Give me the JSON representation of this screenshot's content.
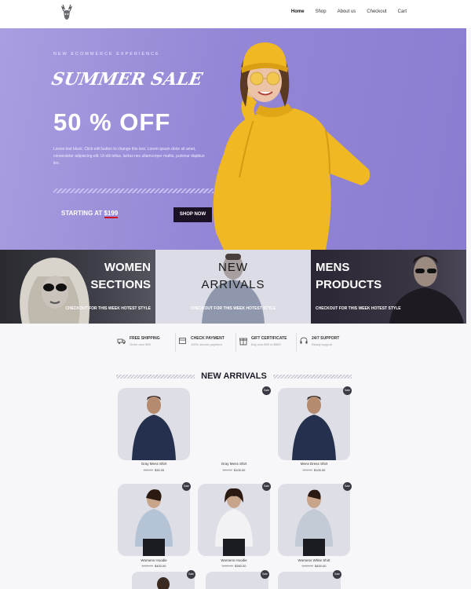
{
  "nav": {
    "items": [
      "Home",
      "Shop",
      "About us",
      "Checkout",
      "Cart"
    ]
  },
  "hero": {
    "tagline": "NEW ECOMMERCE EXPERIENCE",
    "script_title": "SUMMER SALE",
    "headline": "50 % OFF",
    "body": "Lorem text block. Click edit button to change this text. Lorem ipsum dolor sit amet, consectetur adipiscing elit. Ut elit tellus, luctus nec ullamcorper mattis, pulvinar dapibus leo.",
    "price_label": "STARTING AT",
    "price_value": "$199",
    "button_label": "SHOP NOW"
  },
  "categories": [
    {
      "title_line1": "WOMEN",
      "title_line2": "SECTIONS",
      "subtitle": "CHECKOUT FOR THIS WEEK HOTEST STYLE"
    },
    {
      "title_line1": "NEW",
      "title_line2": "ARRIVALS",
      "subtitle": "CHECKOUT FOR THIS WEEK HOTEST STYLE"
    },
    {
      "title_line1": "MENS",
      "title_line2": "PRODUCTS",
      "subtitle": "CHECKOUT FOR THIS WEEK HOTEST STYLE"
    }
  ],
  "features": [
    {
      "title": "FREE SHIPPING",
      "subtitle": "Order over $99",
      "icon": "truck-icon"
    },
    {
      "title": "CHECK PAYMENT",
      "subtitle": "100% secure payment",
      "icon": "card-icon"
    },
    {
      "title": "GIFT CERTIFICATE",
      "subtitle": "Buy now $99 to $500",
      "icon": "gift-icon"
    },
    {
      "title": "24/7 SUPPORT",
      "subtitle": "Ready support",
      "icon": "headset-icon"
    }
  ],
  "new_arrivals": {
    "title": "NEW ARRIVALS",
    "sale_badge": "Sale",
    "products": [
      {
        "name": "Gray Mens Shirt",
        "old_price": "$38.00",
        "price": "$30.00"
      },
      {
        "name": "Gray Mens Shirt",
        "old_price": "$99.00",
        "price": "$105.00"
      },
      {
        "name": "Mens Dress Shirt",
        "old_price": "$99.00",
        "price": "$105.00"
      },
      {
        "name": "Womens Hoodie",
        "old_price": "$430.00",
        "price": "$400.00"
      },
      {
        "name": "Womens Hoodie",
        "old_price": "$430.00",
        "price": "$350.00"
      },
      {
        "name": "Womens White Shirt",
        "old_price": "$480.00",
        "price": "$400.00"
      }
    ]
  },
  "colors": {
    "hero_bg": "#9487d6",
    "sweater": "#f0b822",
    "button_dark": "#1a1224",
    "underline_red": "#d01020"
  }
}
